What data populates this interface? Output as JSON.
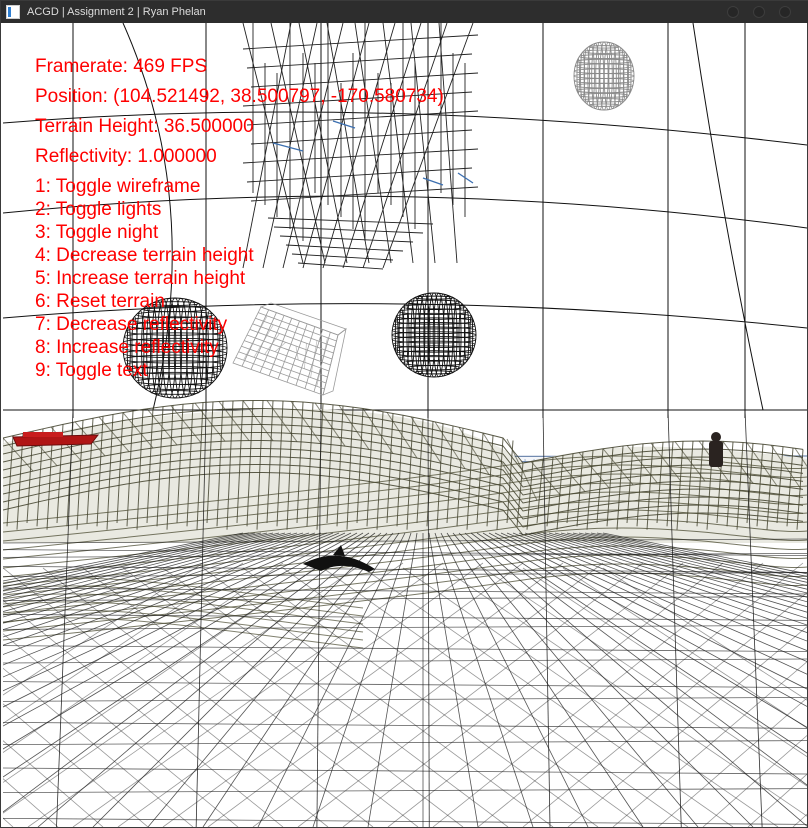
{
  "window": {
    "title": "ACGD | Assignment 2 | Ryan Phelan",
    "icon": "app-window-icon",
    "controls": [
      "minimize-icon",
      "maximize-icon",
      "close-icon"
    ]
  },
  "hud": {
    "color": "#ff0000",
    "framerate": "Framerate: 469 FPS",
    "position": "Position: (104.521492, 38.500797, -170.580734)",
    "terrain_height": "Terrain Height: 36.500000",
    "reflectivity": "Reflectivity: 1.000000",
    "keys": [
      "1: Toggle wireframe",
      "2: Toggle lights",
      "3: Toggle night",
      "4: Decrease terrain height",
      "5: Increase terrain height",
      "6: Reset terrain",
      "7: Decrease reflectivity",
      "8: Increase reflectivity",
      "9: Toggle text"
    ]
  },
  "scene": {
    "mode": "wireframe",
    "background": "#ffffff",
    "terrain_color": "#3f3f2a",
    "water_color": "#2a4f86",
    "sky_grid_color": "#111111",
    "objects": [
      "black-wireframe-sphere",
      "white-wireframe-cube",
      "black-wireframe-sphere",
      "white-wireframe-sphere",
      "red-boat",
      "dark-figure",
      "black-dolphin"
    ]
  }
}
